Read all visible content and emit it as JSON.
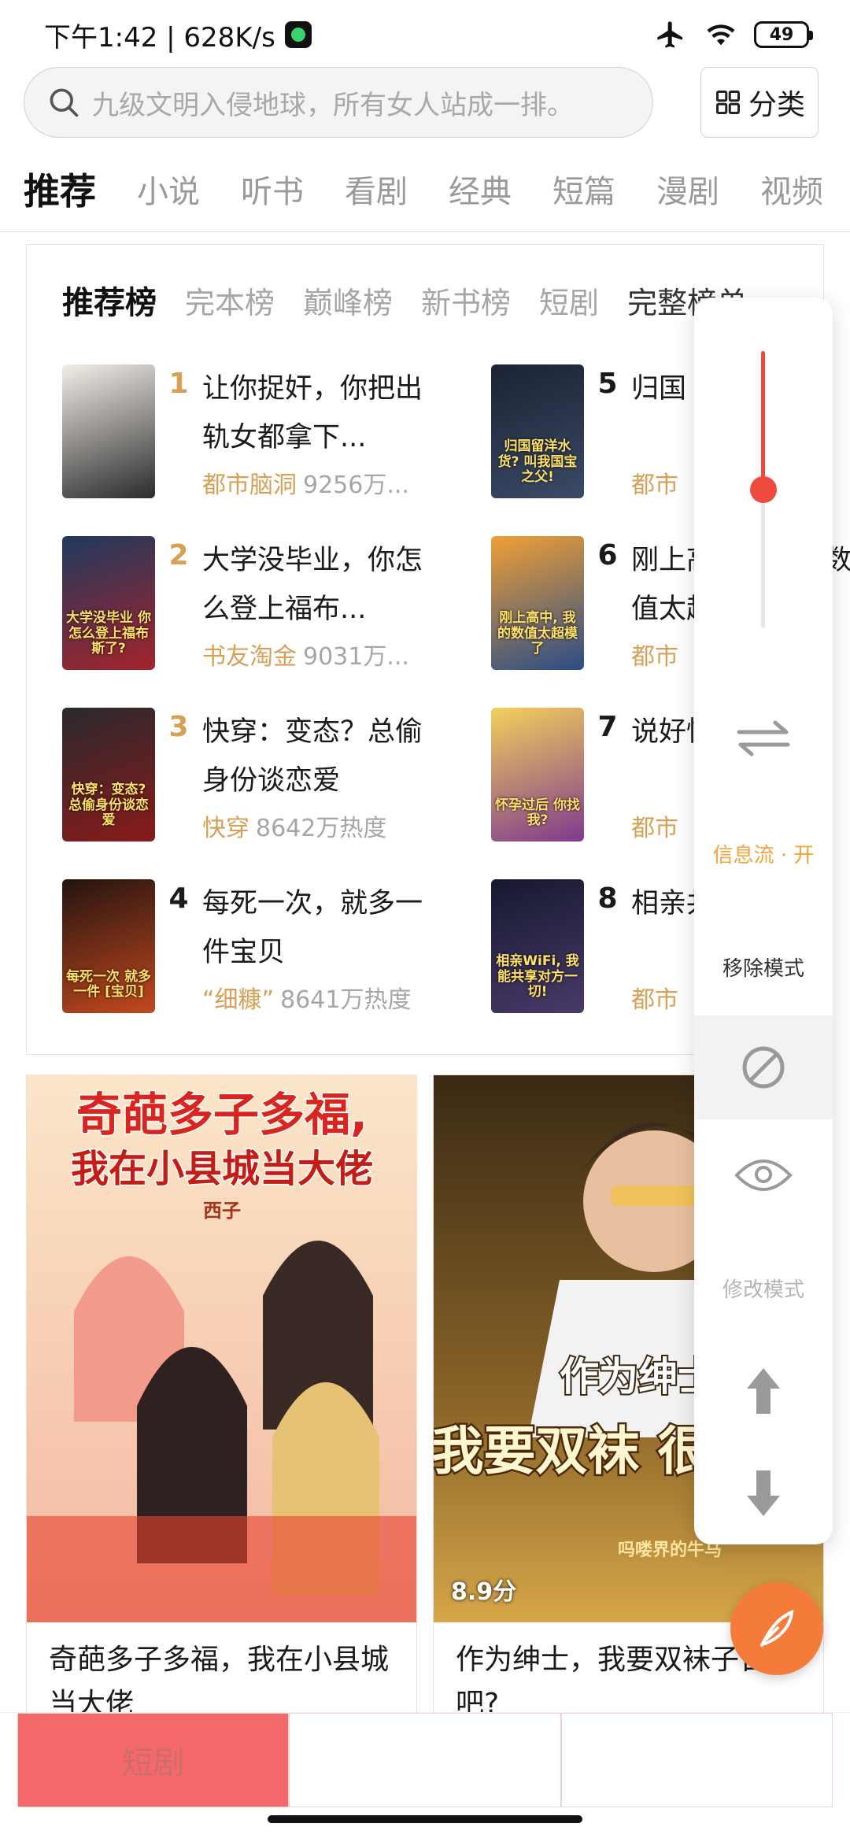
{
  "status_bar": {
    "time": "下午1:42 | 628K/s",
    "battery": "49"
  },
  "search": {
    "placeholder": "九级文明入侵地球，所有女人站成一排。",
    "category_label": "分类"
  },
  "top_tabs": [
    "推荐",
    "小说",
    "听书",
    "看剧",
    "经典",
    "短篇",
    "漫剧",
    "视频"
  ],
  "rank_tabs": [
    "推荐榜",
    "完本榜",
    "巅峰榜",
    "新书榜",
    "短剧",
    "完整榜单"
  ],
  "books": [
    {
      "rank": "1",
      "title": "让你捉奸，你把出轨女都拿下...",
      "genre": "都市脑洞",
      "heat": "9256万...",
      "cover_colors": [
        "#f3eee8",
        "#2b2b2b"
      ]
    },
    {
      "rank": "2",
      "title": "大学没毕业，你怎么登上福布...",
      "genre": "书友淘金",
      "heat": "9031万...",
      "cover_colors": [
        "#1f3a5e",
        "#a5232b"
      ],
      "cover_text": "大学没毕业 你怎么登上福布斯了?"
    },
    {
      "rank": "3",
      "title": "快穿：变态？总偷身份谈恋爱",
      "genre": "快穿",
      "heat": "8642万热度",
      "cover_colors": [
        "#2a2a2e",
        "#8a1a1a"
      ],
      "cover_text": "快穿：变态? 总偷身份谈恋爱"
    },
    {
      "rank": "4",
      "title": "每死一次，就多一件宝贝",
      "genre": "“细糠”",
      "heat": "8641万热度",
      "cover_colors": [
        "#241410",
        "#c2481e"
      ],
      "cover_text": "每死一次 就多一件 [宝贝]"
    },
    {
      "rank": "5",
      "title": "归国",
      "genre": "都市",
      "heat": "",
      "cover_colors": [
        "#1b2334",
        "#3b4a66"
      ],
      "cover_text": "归国留洋水货? 叫我国宝之父!"
    },
    {
      "rank": "6",
      "title": "刚上高中，我的数值太超模了",
      "genre": "都市",
      "heat": "",
      "cover_colors": [
        "#f0a036",
        "#2a4c86"
      ],
      "cover_text": "刚上高中, 我的数值太超模了"
    },
    {
      "rank": "7",
      "title": "说好怀孕",
      "genre": "都市",
      "heat": "",
      "cover_colors": [
        "#f3d05c",
        "#7e3a8e"
      ],
      "cover_text": "怀孕过后 你找我?"
    },
    {
      "rank": "8",
      "title": "相亲共享",
      "genre": "都市",
      "heat": "",
      "cover_colors": [
        "#14192e",
        "#4a3a6a"
      ],
      "cover_text": "相亲WiFi, 我能共享对方一切!"
    }
  ],
  "feed": [
    {
      "title": "奇葩多子多福，我在小县城当大佬",
      "cover_title_1": "奇葩多子多福,",
      "cover_title_2": "我在小县城当大佬",
      "cover_author": "西子",
      "score": ""
    },
    {
      "title": "作为绅士，我要双袜子合理吧?",
      "cover_title_1": "作为绅士",
      "cover_title_2": "我要双袜 很合理",
      "cover_author": "吗喽界的牛马",
      "score": "8.9分"
    }
  ],
  "panel": {
    "slider_level": 0.5,
    "feed_label": "信息流 · 开",
    "remove_label": "移除模式",
    "edit_label": "修改模式",
    "accent": "#ee4a40",
    "feed_color": "#f2a33a"
  },
  "bottom_nav": [
    "短剧",
    "",
    ""
  ]
}
